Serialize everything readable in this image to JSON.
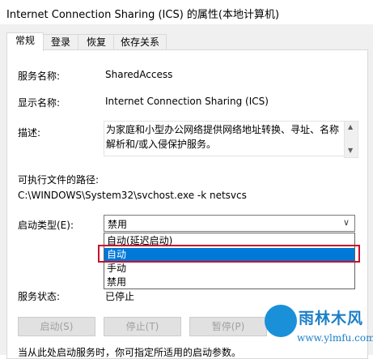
{
  "window": {
    "title": "Internet Connection Sharing (ICS) 的属性(本地计算机)"
  },
  "tabs": [
    {
      "label": "常规"
    },
    {
      "label": "登录"
    },
    {
      "label": "恢复"
    },
    {
      "label": "依存关系"
    }
  ],
  "general": {
    "service_name_label": "服务名称:",
    "service_name_value": "SharedAccess",
    "display_name_label": "显示名称:",
    "display_name_value": "Internet Connection Sharing (ICS)",
    "description_label": "描述:",
    "description_value": "为家庭和小型办公网络提供网络地址转换、寻址、名称解析和/或入侵保护服务。",
    "exe_path_label": "可执行文件的路径:",
    "exe_path_value": "C:\\WINDOWS\\System32\\svchost.exe -k netsvcs",
    "startup_type_label": "启动类型(E):",
    "startup_type_selected": "禁用",
    "startup_options": [
      {
        "label": "自动(延迟启动)"
      },
      {
        "label": "自动"
      },
      {
        "label": "手动"
      },
      {
        "label": "禁用"
      }
    ],
    "highlighted_option_index": 1,
    "service_status_label": "服务状态:",
    "service_status_value": "已停止"
  },
  "buttons": {
    "start": "启动(S)",
    "stop": "停止(T)",
    "pause": "暂停(P)"
  },
  "footer_text": "当从此处启动服务时，你可指定所适用的启动参数。",
  "watermark": {
    "text": "雨林木风",
    "url": "www.ylmfu.com"
  },
  "colors": {
    "selection": "#0078d7",
    "highlight_box": "#c8102e",
    "watermark": "#1a7fc8"
  }
}
